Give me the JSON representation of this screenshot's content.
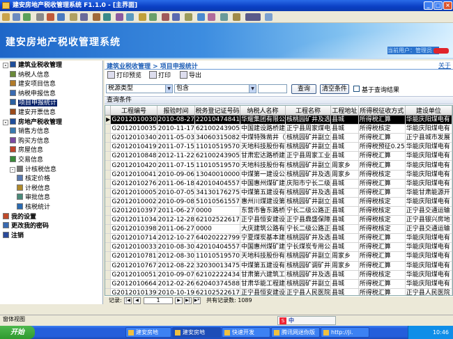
{
  "window": {
    "title": "建安房地产税收管理系统 F1.1.0 - [主界面]"
  },
  "banner": {
    "title": "建安房地产税收管理系统",
    "user_label": "当前用户：管理员"
  },
  "sidebar": [
    {
      "label": "建筑业税收管理",
      "level": 0,
      "toggle": "⊟",
      "bold": true,
      "icon_color": "#1f4e9a"
    },
    {
      "label": "纳税人信息",
      "level": 1,
      "icon_color": "#6a8a3a"
    },
    {
      "label": "建安项目信息",
      "level": 1,
      "icon_color": "#b07a2a"
    },
    {
      "label": "纳税申报信息",
      "level": 1,
      "icon_color": "#3a6ab0"
    },
    {
      "label": "项目申报统计",
      "level": 1,
      "selected": true,
      "icon_color": "#2a5fa0"
    },
    {
      "label": "建安开票信息",
      "level": 1,
      "icon_color": "#9a4a1a"
    },
    {
      "label": "房地产税收管理",
      "level": 0,
      "toggle": "⊟",
      "bold": true,
      "icon_color": "#1f4e9a"
    },
    {
      "label": "销售方信息",
      "level": 1,
      "icon_color": "#3a7ab0"
    },
    {
      "label": "购买方信息",
      "level": 1,
      "icon_color": "#7a4aa0"
    },
    {
      "label": "房屋信息",
      "level": 1,
      "icon_color": "#c0442a"
    },
    {
      "label": "交易信息",
      "level": 1,
      "icon_color": "#3a8a3a"
    },
    {
      "label": "计核税信息",
      "level": 1,
      "toggle": "⊟",
      "icon_color": "#777"
    },
    {
      "label": "核定价格",
      "level": 2,
      "icon_color": "#5a7ab0"
    },
    {
      "label": "计税信息",
      "level": 2,
      "icon_color": "#b08a2a"
    },
    {
      "label": "审批信息",
      "level": 2,
      "icon_color": "#4a8a7a"
    },
    {
      "label": "核税统计",
      "level": 2,
      "icon_color": "#2a6ab0"
    },
    {
      "label": "我的设置",
      "level": 0,
      "bold": true,
      "icon_color": "#c04a2a"
    },
    {
      "label": "更改我的密码",
      "level": 0,
      "bold": true,
      "icon_color": "#3a6ab0"
    },
    {
      "label": "注销",
      "level": 0,
      "bold": true,
      "icon_color": "#2a4a9a"
    }
  ],
  "main": {
    "breadcrumb": "建筑业税收管理 > 项目申报统计",
    "close": "关于",
    "actions": [
      "打印预览",
      "打印",
      "导出"
    ],
    "filter": {
      "field": "税源类型",
      "op": "包含",
      "value": "",
      "query": "查询",
      "clear": "清空条件",
      "within": "基于查询结果"
    },
    "query_title": "查询条件"
  },
  "table": {
    "columns": [
      "工程编号",
      "报验时间",
      "税务登记证号码",
      "纳税人名称",
      "工程名称",
      "工程地址",
      "所得税征收方式",
      "建设单位"
    ],
    "rows": [
      [
        "G2012010030",
        "2010-08-27",
        "22010474841",
        "华耀集团有限公",
        "核桃园矿井及选",
        "县城",
        "所得税汇算",
        "华能庆阳煤电有"
      ],
      [
        "G2012010035",
        "2010-11-17",
        "62100243905",
        "中国建设路桥建",
        "正宁县周家煤电",
        "县城",
        "所得税核定",
        "华能庆阳煤电有"
      ],
      [
        "G2012010340",
        "2011-05-03",
        "34060315082",
        "中煤特殊凿井（",
        "核桃园矿井副立",
        "县城",
        "所得税汇算",
        "正宁县城市发展"
      ],
      [
        "G2012010419",
        "2011-07-15",
        "11010519570",
        "天地科技股份有",
        "核桃园矿井副立",
        "县城",
        "所得税预征0.25",
        "华能庆阳煤电有"
      ],
      [
        "G2012010848",
        "2012-11-22",
        "62100243905",
        "甘肃宏达路桥建",
        "正宁县周家工业",
        "县城",
        "所得税汇算",
        "华能庆阳煤电有"
      ],
      [
        "G2012010420",
        "2011-07-15",
        "11010519570",
        "天地科技股份有",
        "核桃园矿井副立",
        "周家乡",
        "所得税汇算",
        "华能庆阳煤电有"
      ],
      [
        "G2012010041",
        "2010-09-06",
        "13040010000",
        "中煤第一建设公",
        "核桃园矿井及选",
        "周家乡",
        "所得税核定",
        "华能庆阳煤电有"
      ],
      [
        "G2012010276",
        "2011-06-18",
        "42010404557",
        "中国惠州煤矿建",
        "庆阳市宁长二级",
        "县城",
        "所得税汇算",
        "华能庆阳煤电有"
      ],
      [
        "G2012010005",
        "2010-07-05",
        "34130176275",
        "中煤第五建设有",
        "核桃园矿井及选",
        "县城",
        "所得税汇算",
        "华能甘肃能源开"
      ],
      [
        "G2012010002",
        "2010-09-08",
        "51010561557",
        "惠州川煤建设第",
        "核桃园矿井副立",
        "县城",
        "所得税核定",
        "华能庆阳煤电有"
      ],
      [
        "G2012010397",
        "2011-06-27",
        "0000",
        "东营市鲁东路桥",
        "宁长二级公路正",
        "县城",
        "所得税核定",
        "正宁县交通运输"
      ],
      [
        "G2012011034",
        "2012-12-28",
        "62102522617",
        "正宁县恒安建设",
        "正宁县鼎盛保障",
        "县城",
        "所得税核定",
        "正宁县银兴房地"
      ],
      [
        "G2012010398",
        "2011-06-27",
        "0000",
        "大庆建筑公路有",
        "宁长二级公路正",
        "县城",
        "所得税核定",
        "正宁县交通运输"
      ],
      [
        "G2012010714",
        "2012-10-27",
        "64020222799",
        "宁夏煤炭基本建",
        "核桃园矿井及选",
        "县城",
        "所得税汇算",
        "华能庆阳煤电有"
      ],
      [
        "G2012010033",
        "2010-08-30",
        "42010404557",
        "中国惠州煤矿建",
        "宁长煤炭专用公",
        "县城",
        "所得税汇算",
        "华能庆阳煤电有"
      ],
      [
        "G2012010781",
        "2012-08-30",
        "11010519570",
        "天地科技股份有",
        "核桃园矿井副立",
        "周家乡",
        "所得税汇算",
        "华能庆阳煤电有"
      ],
      [
        "G2012010767",
        "2012-08-22",
        "32030013475",
        "中煤第五建设有",
        "核桃园矿调矿井",
        "周家乡",
        "所得税汇算",
        "华能庆阳煤电有"
      ],
      [
        "G2012010051",
        "2010-09-07",
        "62102222434",
        "甘肃第六建筑工",
        "核桃园矿井及选",
        "县城",
        "所得税核定",
        "华能庆阳煤电有"
      ],
      [
        "G2012010664",
        "2012-02-26",
        "62040374588",
        "甘肃华能工程建",
        "核桃园矿井副立",
        "县城",
        "所得税汇算",
        "华能庆阳煤电有"
      ],
      [
        "G2012010139",
        "2010-10-19",
        "62102522617",
        "正宁县恒安建设",
        "正宁县人民医院",
        "县城",
        "所得税汇算",
        "正宁县人民医院"
      ]
    ],
    "highlight": 0
  },
  "pager": {
    "label": "记录:",
    "page": "1",
    "total": "共有记录数: 1089"
  },
  "statusbar": {
    "text": "窗体视图"
  },
  "ime": {
    "label": "中"
  },
  "taskbar": {
    "start": "开始",
    "tasks": [
      "建安房地",
      "建安房地",
      "快速开发",
      "腾讯网迷你版",
      "http://ji."
    ],
    "clock": "10:46"
  }
}
